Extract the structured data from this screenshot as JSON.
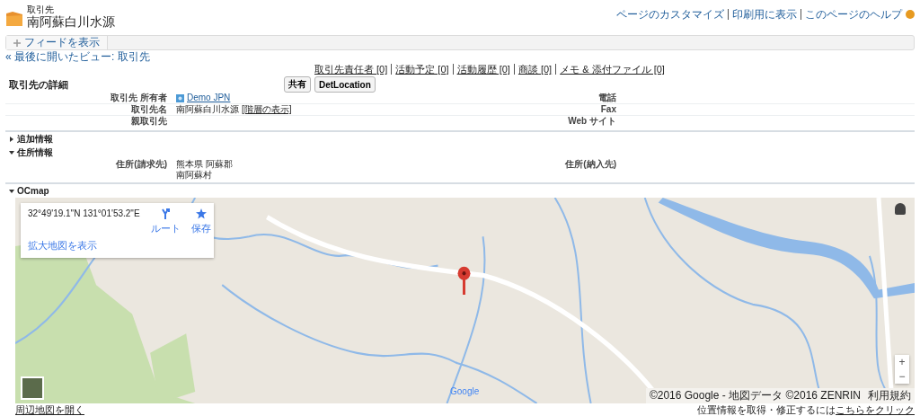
{
  "header": {
    "object_type": "取引先",
    "title": "南阿蘇白川水源",
    "links": [
      "ページのカスタマイズ",
      "印刷用に表示",
      "このページのヘルプ"
    ]
  },
  "feed_button": "フィードを表示",
  "breadcrumb": "« 最後に開いたビュー: 取引先",
  "related_links": [
    "取引先責任者 [0]",
    "活動予定 [0]",
    "活動履歴 [0]",
    "商談 [0]",
    "メモ & 添付ファイル [0]"
  ],
  "detail": {
    "title": "取引先の詳細",
    "buttons": [
      "共有",
      "DetLocation"
    ],
    "rows": [
      {
        "label": "取引先 所有者",
        "kind": "user",
        "value": "Demo JPN",
        "right_label": "電話"
      },
      {
        "label": "取引先名",
        "kind": "text",
        "value": "南阿蘇白川水源",
        "link": "[階層の表示]",
        "right_label": "Fax"
      },
      {
        "label": "親取引先",
        "kind": "text",
        "right_label": "Web サイト"
      }
    ]
  },
  "sections": [
    {
      "title": "追加情報",
      "expanded": false,
      "kind": "fields"
    },
    {
      "title": "住所情報",
      "expanded": true,
      "kind": "fields",
      "rows": [
        {
          "label": "住所(請求先)",
          "lines": [
            "熊本県 阿蘇郡",
            "南阿蘇村"
          ],
          "right_label": "住所(納入先)"
        }
      ]
    },
    {
      "title": "OCmap",
      "expanded": true,
      "kind": "map"
    }
  ],
  "map": {
    "coordinates": "32°49'19.1\"N 131°01'53.2\"E",
    "actions": [
      {
        "label": "ルート",
        "kind": "directions"
      },
      {
        "label": "保存",
        "kind": "save"
      }
    ],
    "larger_map_link": "拡大地図を表示",
    "logo": "Google",
    "attribution": "©2016 Google - 地図データ ©2016 ZENRIN",
    "terms": "利用規約",
    "zoom_in": "+",
    "zoom_out": "−"
  },
  "footer": {
    "left_link": "周辺地図を開く",
    "right_text": "位置情報を取得・修正するには",
    "right_link": "こちらをクリック"
  }
}
